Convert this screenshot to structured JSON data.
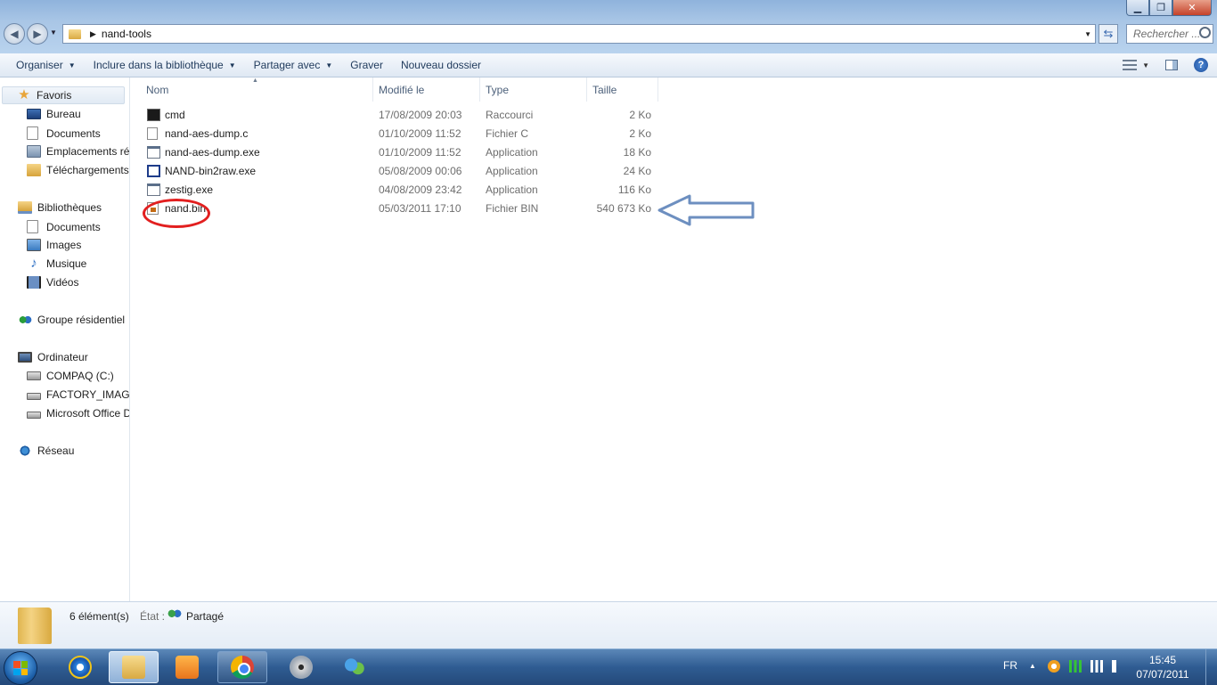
{
  "window": {
    "controls": {
      "minimize": "▁",
      "maximize": "❐",
      "close": "✕"
    }
  },
  "address": {
    "path": "nand-tools"
  },
  "search": {
    "placeholder": "Rechercher ..."
  },
  "toolbar": {
    "organize": "Organiser",
    "include": "Inclure dans la bibliothèque",
    "share": "Partager avec",
    "burn": "Graver",
    "new_folder": "Nouveau dossier",
    "help": "?"
  },
  "nav": {
    "favorites": {
      "label": "Favoris",
      "items": [
        "Bureau",
        "Documents",
        "Emplacements récents",
        "Téléchargements"
      ]
    },
    "libraries": {
      "label": "Bibliothèques",
      "items": [
        "Documents",
        "Images",
        "Musique",
        "Vidéos"
      ]
    },
    "homegroup": "Groupe résidentiel",
    "computer": {
      "label": "Ordinateur",
      "items": [
        "COMPAQ (C:)",
        "FACTORY_IMAGE",
        "Microsoft Office D"
      ]
    },
    "network": "Réseau"
  },
  "columns": {
    "name": "Nom",
    "modified": "Modifié le",
    "type": "Type",
    "size": "Taille"
  },
  "files": [
    {
      "name": "cmd",
      "date": "17/08/2009 20:03",
      "type": "Raccourci",
      "size": "2 Ko",
      "icon": "shortcut-icon"
    },
    {
      "name": "nand-aes-dump.c",
      "date": "01/10/2009 11:52",
      "type": "Fichier C",
      "size": "2 Ko",
      "icon": "text-file-icon"
    },
    {
      "name": "nand-aes-dump.exe",
      "date": "01/10/2009 11:52",
      "type": "Application",
      "size": "18 Ko",
      "icon": "application-icon"
    },
    {
      "name": "NAND-bin2raw.exe",
      "date": "05/08/2009 00:06",
      "type": "Application",
      "size": "24 Ko",
      "icon": "window-application-icon"
    },
    {
      "name": "zestig.exe",
      "date": "04/08/2009 23:42",
      "type": "Application",
      "size": "116 Ko",
      "icon": "application-icon"
    },
    {
      "name": "nand.bin",
      "date": "05/03/2011 17:10",
      "type": "Fichier BIN",
      "size": "540 673 Ko",
      "icon": "bin-file-icon"
    }
  ],
  "details": {
    "count": "6 élément(s)",
    "state_label": "État :",
    "state_value": "Partagé"
  },
  "taskbar": {
    "lang": "FR",
    "time": "15:45",
    "date": "07/07/2011"
  },
  "annotation_colors": {
    "circle": "#e21f1f",
    "arrow": "#6d8fc0"
  }
}
